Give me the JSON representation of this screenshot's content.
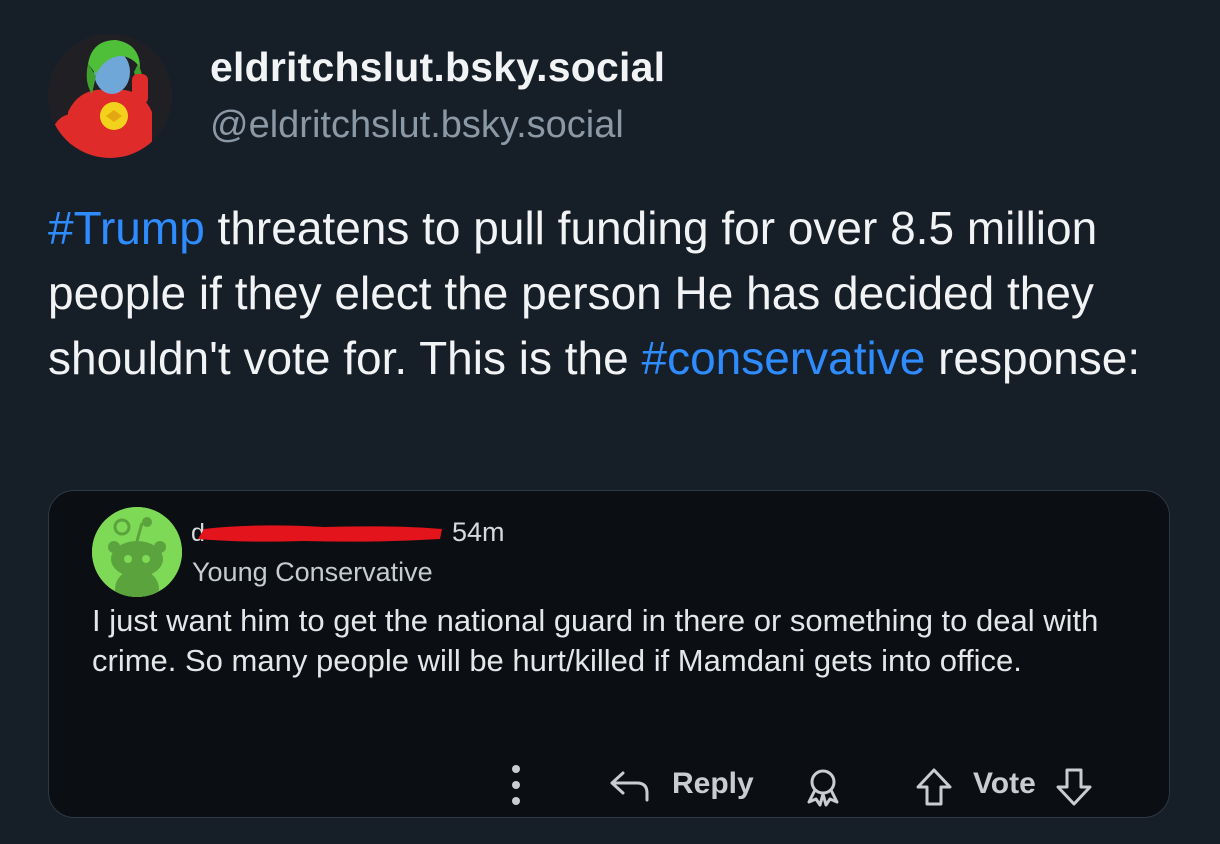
{
  "author": {
    "display_name": "eldritchslut.bsky.social",
    "handle": "@eldritchslut.bsky.social"
  },
  "post": {
    "hashtag1": "#Trump",
    "text1": " threatens to pull funding for over 8.5 million people if they elect the person He has decided they shouldn't vote for. This is the ",
    "hashtag2": "#conservative",
    "text2": " response:"
  },
  "quoted": {
    "username_visible": "d",
    "time": "54m",
    "flair": "Young Conservative",
    "comment": "I just want him to get the national guard in there or something to deal with crime. So many people will be hurt/killed if Mamdani gets into office.",
    "reply_label": "Reply",
    "vote_label": "Vote"
  },
  "colors": {
    "background": "#161e27",
    "hashtag": "#2f8cff",
    "handle": "#8b98a5",
    "card_bg": "#0b0e12",
    "snoo_bg": "#7ed957",
    "redaction": "#e3141c"
  }
}
